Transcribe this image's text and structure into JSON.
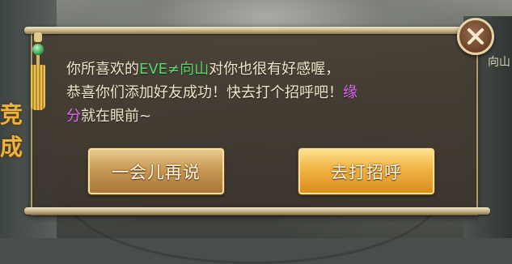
{
  "scene": {
    "banner_text": "竞成",
    "npc_name": "向山"
  },
  "dialog": {
    "message": {
      "line1_prefix": "你所喜欢的",
      "line1_name": "EVE≠向山",
      "line1_suffix": "对你也很有好感喔，",
      "line2_text": "恭喜你们添加好友成功！快去打个招呼吧！",
      "line2_fate": "缘",
      "line3_fate": "分",
      "line3_text": "就在眼前~"
    },
    "buttons": {
      "later_label": "一会儿再说",
      "greet_label": "去打招呼"
    },
    "close_icon": "close-icon"
  },
  "colors": {
    "name_highlight": "#55d86a",
    "fate_highlight": "#e26bf2",
    "text": "#f1e6c8"
  }
}
